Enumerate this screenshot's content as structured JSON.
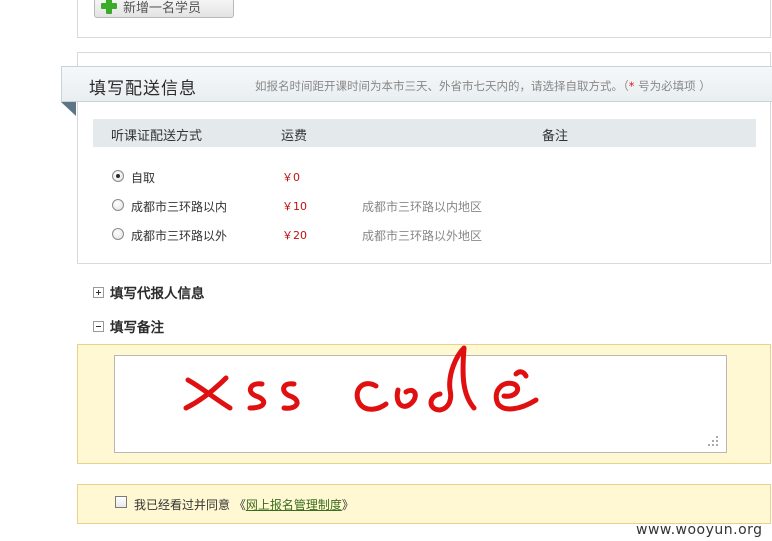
{
  "top": {
    "add_student_label": "新增一名学员"
  },
  "delivery": {
    "title": "填写配送信息",
    "note_prefix": "如报名时间距开课时间为本市三天、外省市七天内的，请选择自取方式。（",
    "note_star": "*",
    "note_suffix": " 号为必填项 ）",
    "columns": [
      "听课证配送方式",
      "运费",
      "备注"
    ],
    "options": [
      {
        "label": "自取",
        "fee": "￥0",
        "remark": "",
        "checked": true
      },
      {
        "label": "成都市三环路以内",
        "fee": "￥10",
        "remark": "成都市三环路以内地区",
        "checked": false
      },
      {
        "label": "成都市三环路以外",
        "fee": "￥20",
        "remark": "成都市三环路以外地区",
        "checked": false
      }
    ]
  },
  "sections": {
    "proxy_title": "填写代报人信息",
    "remark_title": "填写备注"
  },
  "remark": {
    "value": "xss code"
  },
  "agree": {
    "text_prefix": "我已经看过并同意 《",
    "link_text": "网上报名管理制度",
    "text_suffix": "》"
  },
  "watermark": "www.wooyun.org",
  "colors": {
    "accent_red": "#c0120f",
    "ribbon_dark": "#5d7686",
    "yellow_bg": "#fff8d2",
    "scribble": "#e01010"
  },
  "icons": {
    "add": "plus-icon",
    "expand": "expand-plus-icon",
    "collapse": "collapse-minus-icon"
  }
}
